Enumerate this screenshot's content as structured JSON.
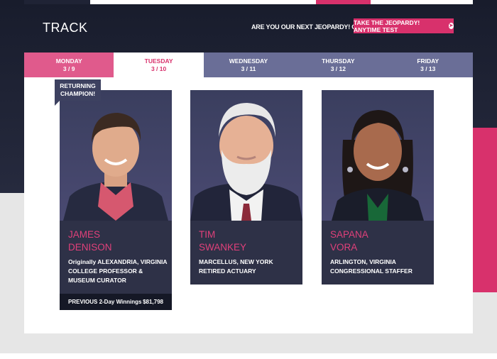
{
  "header": {
    "title": "TRACK",
    "promo_text": "ARE YOU OUR NEXT JEOPARDY! CHAMPION?",
    "promo_button": "TAKE THE JEOPARDY! ANYTIME TEST",
    "colors": {
      "brand_pink": "#d8316c",
      "dark": "#1c2031",
      "tab_inactive": "#6a6e97"
    }
  },
  "tabs": [
    {
      "day": "MONDAY",
      "date": "3 / 9"
    },
    {
      "day": "TUESDAY",
      "date": "3 / 10"
    },
    {
      "day": "WEDNESDAY",
      "date": "3 / 11"
    },
    {
      "day": "THURSDAY",
      "date": "3 / 12"
    },
    {
      "day": "FRIDAY",
      "date": "3 / 13"
    }
  ],
  "badge": {
    "line1": "RETURNING",
    "line2": "CHAMPION!"
  },
  "contestants": [
    {
      "first": "JAMES",
      "last": "DENISON",
      "info1": "Originally ALEXANDRIA, VIRGINIA",
      "info2": "COLLEGE PROFESSOR &",
      "info3": "MUSEUM CURATOR",
      "winnings_label": "PREVIOUS 2-Day Winnings",
      "winnings_value": "$81,798"
    },
    {
      "first": "TIM",
      "last": "SWANKEY",
      "info1": "MARCELLUS, NEW YORK",
      "info2": "RETIRED ACTUARY"
    },
    {
      "first": "SAPANA",
      "last": "VORA",
      "info1": "ARLINGTON, VIRGINIA",
      "info2": "CONGRESSIONAL STAFFER"
    }
  ]
}
